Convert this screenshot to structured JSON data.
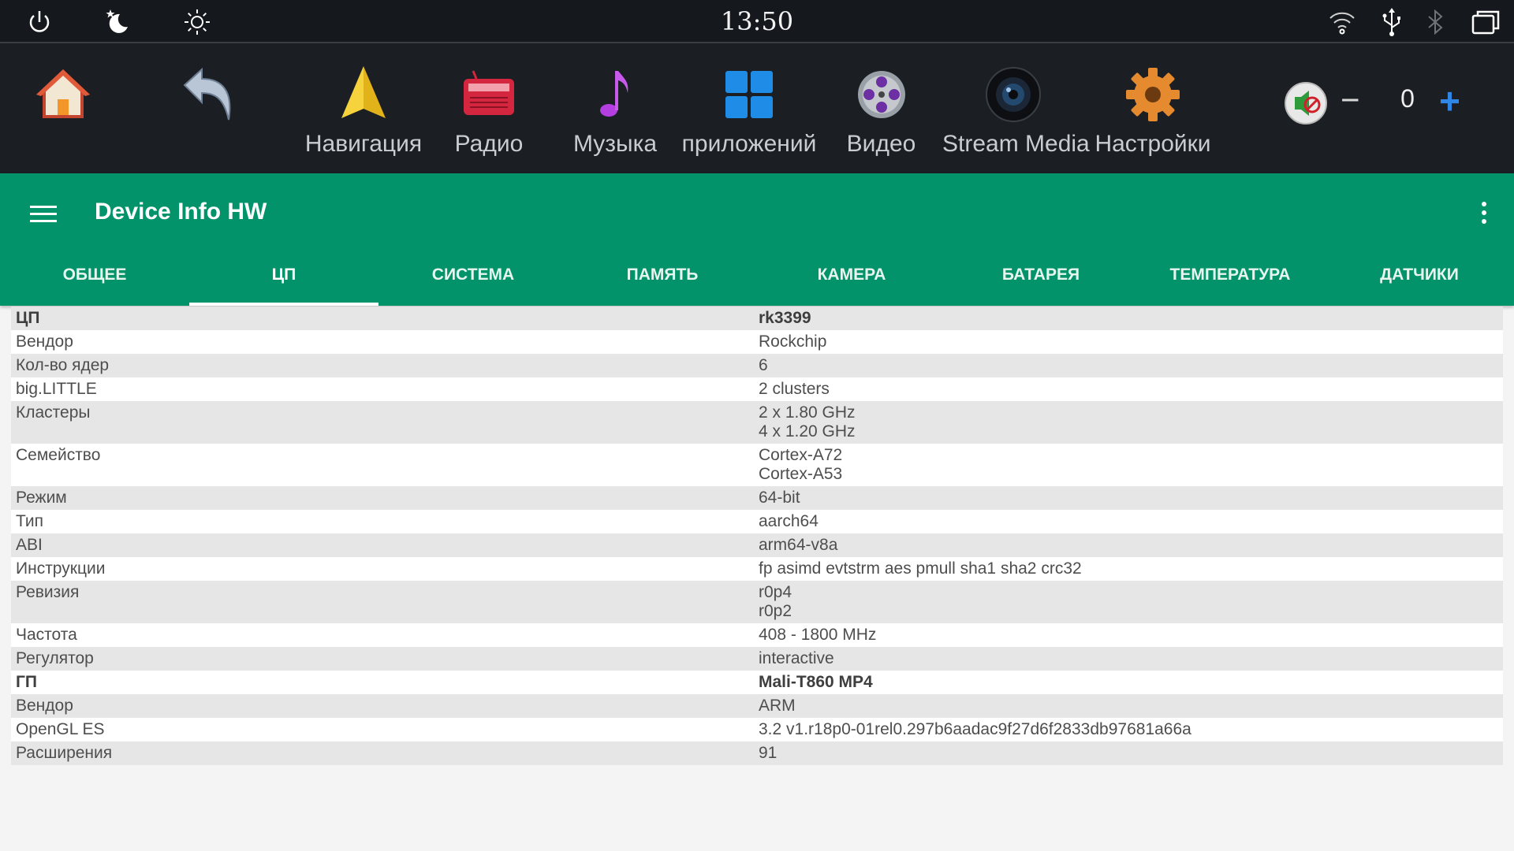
{
  "status_bar": {
    "time": "13:50",
    "left_icons": [
      "power-icon",
      "night-mode-icon",
      "brightness-icon"
    ],
    "right_icons": [
      "wifi-icon",
      "usb-icon",
      "bluetooth-icon",
      "recent-apps-icon"
    ]
  },
  "launcher": {
    "apps": [
      {
        "label": "",
        "icon": "home-icon"
      },
      {
        "label": "",
        "icon": "back-icon"
      },
      {
        "label": "Навигация",
        "icon": "navigation-icon"
      },
      {
        "label": "Радио",
        "icon": "radio-icon"
      },
      {
        "label": "Музыка",
        "icon": "music-icon"
      },
      {
        "label": "приложений",
        "icon": "apps-icon"
      },
      {
        "label": "Видео",
        "icon": "video-icon"
      },
      {
        "label": "Stream Media",
        "icon": "stream-media-icon"
      },
      {
        "label": "Настройки",
        "icon": "settings-icon"
      }
    ],
    "volume": {
      "icon": "volume-muted-icon",
      "minus": "−",
      "value": "0",
      "plus": "+"
    }
  },
  "appbar": {
    "title": "Device Info HW",
    "tabs": [
      "ОБЩЕЕ",
      "ЦП",
      "СИСТЕМА",
      "ПАМЯТЬ",
      "КАМЕРА",
      "БАТАРЕЯ",
      "ТЕМПЕРАТУРА",
      "ДАТЧИКИ"
    ],
    "active_tab": "ЦП"
  },
  "table": {
    "rows": [
      {
        "key": "ЦП",
        "value": [
          "rk3399"
        ],
        "bold": true
      },
      {
        "key": "Вендор",
        "value": [
          "Rockchip"
        ]
      },
      {
        "key": "Кол-во ядер",
        "value": [
          "6"
        ]
      },
      {
        "key": "big.LITTLE",
        "value": [
          "2 clusters"
        ]
      },
      {
        "key": "Кластеры",
        "value": [
          "2 x 1.80 GHz",
          "4 x 1.20 GHz"
        ]
      },
      {
        "key": "Семейство",
        "value": [
          "Cortex-A72",
          "Cortex-A53"
        ]
      },
      {
        "key": "Режим",
        "value": [
          "64-bit"
        ]
      },
      {
        "key": "Тип",
        "value": [
          "aarch64"
        ]
      },
      {
        "key": "ABI",
        "value": [
          "arm64-v8a"
        ]
      },
      {
        "key": "Инструкции",
        "value": [
          "fp asimd evtstrm aes pmull sha1 sha2 crc32"
        ]
      },
      {
        "key": "Ревизия",
        "value": [
          "r0p4",
          "r0p2"
        ]
      },
      {
        "key": "Частота",
        "value": [
          "408 - 1800 MHz"
        ]
      },
      {
        "key": "Регулятор",
        "value": [
          "interactive"
        ]
      },
      {
        "key": "ГП",
        "value": [
          "Mali-T860 MP4"
        ],
        "bold": true
      },
      {
        "key": "Вендор",
        "value": [
          "ARM"
        ]
      },
      {
        "key": "OpenGL ES",
        "value": [
          "3.2 v1.r18p0-01rel0.297b6aadac9f27d6f2833db97681a66a"
        ]
      },
      {
        "key": "Расширения",
        "value": [
          "91"
        ]
      }
    ]
  },
  "colors": {
    "accent": "#02936b",
    "status_bar_bg": "#15181c",
    "launcher_bg": "#1b1f24",
    "row_alt": "#e6e6e6"
  }
}
